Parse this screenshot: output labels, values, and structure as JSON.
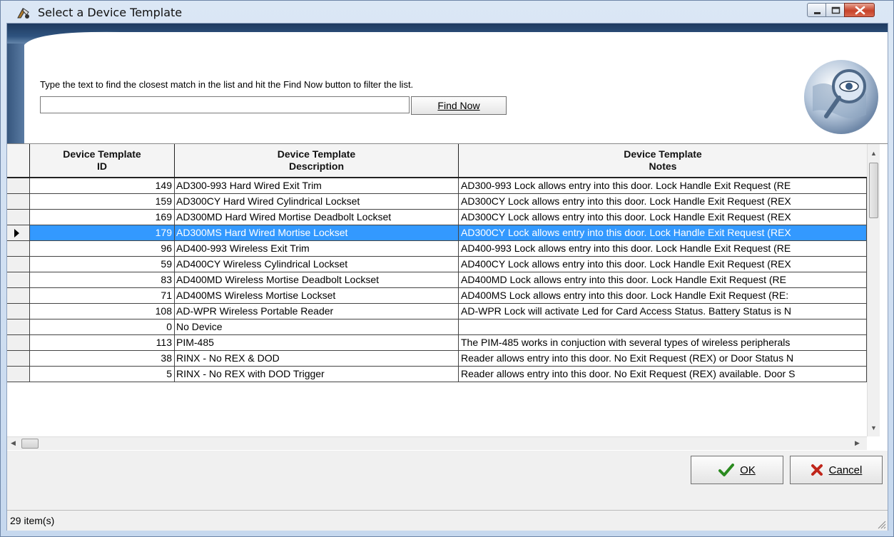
{
  "window": {
    "title": "Select a Device Template"
  },
  "search": {
    "instruction": "Type the text to find the closest match in the list and hit the Find Now button to filter the list.",
    "value": "",
    "find_button_label": "Find Now"
  },
  "grid": {
    "columns": [
      {
        "line1": "Device Template",
        "line2": "ID"
      },
      {
        "line1": "Device Template",
        "line2": "Description"
      },
      {
        "line1": "Device Template",
        "line2": "Notes"
      }
    ],
    "selected_index": 3,
    "rows": [
      {
        "id": "149",
        "description": "AD300-993 Hard Wired Exit Trim",
        "notes": "AD300-993 Lock allows entry into this door. Lock Handle Exit Request (RE"
      },
      {
        "id": "159",
        "description": "AD300CY Hard Wired Cylindrical Lockset",
        "notes": "AD300CY Lock allows entry into this door. Lock Handle Exit Request (REX"
      },
      {
        "id": "169",
        "description": "AD300MD Hard Wired Mortise Deadbolt Lockset",
        "notes": "AD300CY Lock allows entry into this door. Lock Handle Exit Request (REX"
      },
      {
        "id": "179",
        "description": "AD300MS Hard Wired Mortise Lockset",
        "notes": "AD300CY Lock allows entry into this door. Lock Handle Exit Request (REX"
      },
      {
        "id": "96",
        "description": "AD400-993 Wireless Exit Trim",
        "notes": "AD400-993 Lock allows entry into this door. Lock Handle Exit Request (RE"
      },
      {
        "id": "59",
        "description": "AD400CY Wireless Cylindrical Lockset",
        "notes": "AD400CY Lock allows entry into this door. Lock Handle Exit Request (REX"
      },
      {
        "id": "83",
        "description": "AD400MD Wireless Mortise Deadbolt Lockset",
        "notes": "AD400MD Lock allows entry into this door. Lock Handle Exit Request (RE"
      },
      {
        "id": "71",
        "description": "AD400MS Wireless Mortise Lockset",
        "notes": "AD400MS Lock allows entry into this door. Lock Handle Exit Request (RE:"
      },
      {
        "id": "108",
        "description": "AD-WPR Wireless Portable Reader",
        "notes": "AD-WPR Lock will activate Led for Card Access Status. Battery Status is N"
      },
      {
        "id": "0",
        "description": "No Device",
        "notes": ""
      },
      {
        "id": "113",
        "description": "PIM-485",
        "notes": "The PIM-485 works in conjuction with several types of wireless peripherals"
      },
      {
        "id": "38",
        "description": "RINX - No REX & DOD",
        "notes": "Reader allows entry into this door. No Exit Request (REX) or Door Status N"
      },
      {
        "id": "5",
        "description": "RINX - No REX with DOD Trigger",
        "notes": "Reader allows entry into this door. No Exit Request (REX) available. Door S"
      }
    ]
  },
  "footer": {
    "ok_label": "OK",
    "cancel_label": "Cancel",
    "status": "29 item(s)"
  },
  "icons": {
    "app": "device-template-icon",
    "globe": "globe-eye-magnifier-icon",
    "ok": "checkmark-icon",
    "cancel": "x-icon"
  },
  "colors": {
    "selection": "#3399ff",
    "header_bar": "#2e537f",
    "close_button": "#c7432a"
  }
}
